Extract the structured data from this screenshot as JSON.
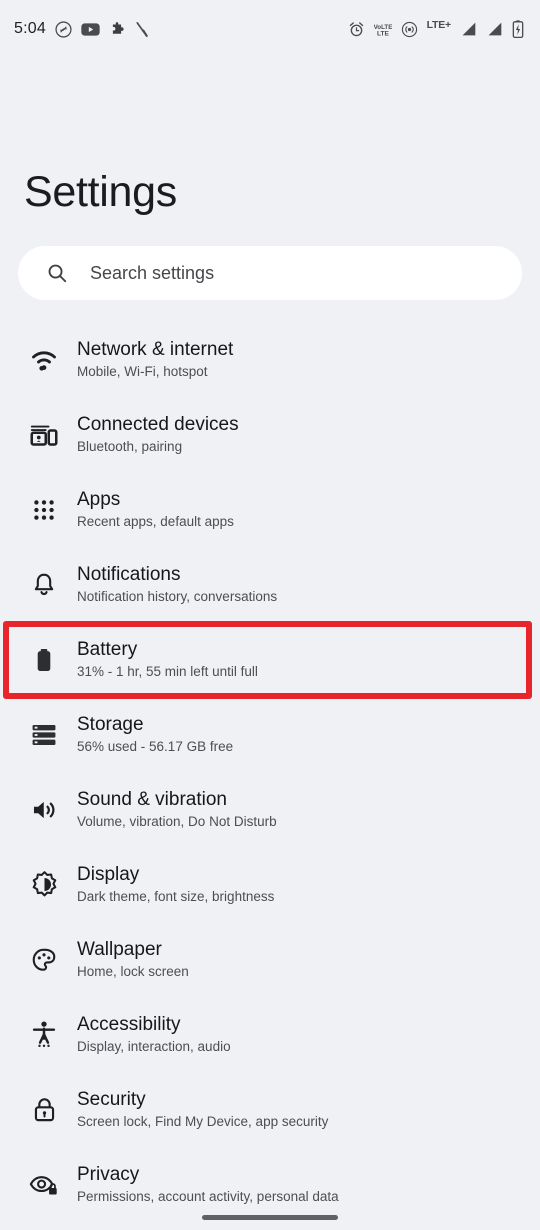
{
  "status_bar": {
    "clock": "5:04",
    "left_icons": [
      "shazam-icon",
      "youtube-icon",
      "puzzle-piece-icon",
      "slash-icon"
    ],
    "right_icons": [
      "alarm-icon",
      "volte-icon",
      "hotspot-icon",
      "lte-plus-icon",
      "signal-bars-icon-1",
      "signal-bars-icon-2",
      "battery-charging-icon"
    ],
    "volte_label": "VoLTE",
    "lte_label": "LTE+"
  },
  "header": {
    "title": "Settings"
  },
  "search": {
    "placeholder": "Search settings",
    "icon": "search-icon"
  },
  "colors": {
    "background": "#eff1f5",
    "search_background": "#ffffff",
    "title_text": "#1b1c1f",
    "row_title": "#16171a",
    "row_subtitle": "#4c4e52",
    "highlight_border": "#e8252a",
    "home_indicator": "#5f6164"
  },
  "highlight": {
    "target": "battery",
    "color": "#e8252a"
  },
  "settings_list": [
    {
      "id": "network-internet",
      "title": "Network & internet",
      "subtitle": "Mobile, Wi-Fi, hotspot",
      "icon": "wifi-icon"
    },
    {
      "id": "connected-devices",
      "title": "Connected devices",
      "subtitle": "Bluetooth, pairing",
      "icon": "cast-devices-icon"
    },
    {
      "id": "apps",
      "title": "Apps",
      "subtitle": "Recent apps, default apps",
      "icon": "apps-grid-icon"
    },
    {
      "id": "notifications",
      "title": "Notifications",
      "subtitle": "Notification history, conversations",
      "icon": "bell-icon"
    },
    {
      "id": "battery",
      "title": "Battery",
      "subtitle": "31% - 1 hr, 55 min left until full",
      "icon": "battery-icon"
    },
    {
      "id": "storage",
      "title": "Storage",
      "subtitle": "56% used - 56.17 GB free",
      "icon": "storage-icon"
    },
    {
      "id": "sound-vibration",
      "title": "Sound & vibration",
      "subtitle": "Volume, vibration, Do Not Disturb",
      "icon": "volume-icon"
    },
    {
      "id": "display",
      "title": "Display",
      "subtitle": "Dark theme, font size, brightness",
      "icon": "brightness-icon"
    },
    {
      "id": "wallpaper",
      "title": "Wallpaper",
      "subtitle": "Home, lock screen",
      "icon": "palette-icon"
    },
    {
      "id": "accessibility",
      "title": "Accessibility",
      "subtitle": "Display, interaction, audio",
      "icon": "accessibility-icon"
    },
    {
      "id": "security",
      "title": "Security",
      "subtitle": "Screen lock, Find My Device, app security",
      "icon": "lock-icon"
    },
    {
      "id": "privacy",
      "title": "Privacy",
      "subtitle": "Permissions, account activity, personal data",
      "icon": "eye-lock-icon"
    }
  ],
  "navigation": {
    "home_indicator": "home-gesture-bar"
  }
}
